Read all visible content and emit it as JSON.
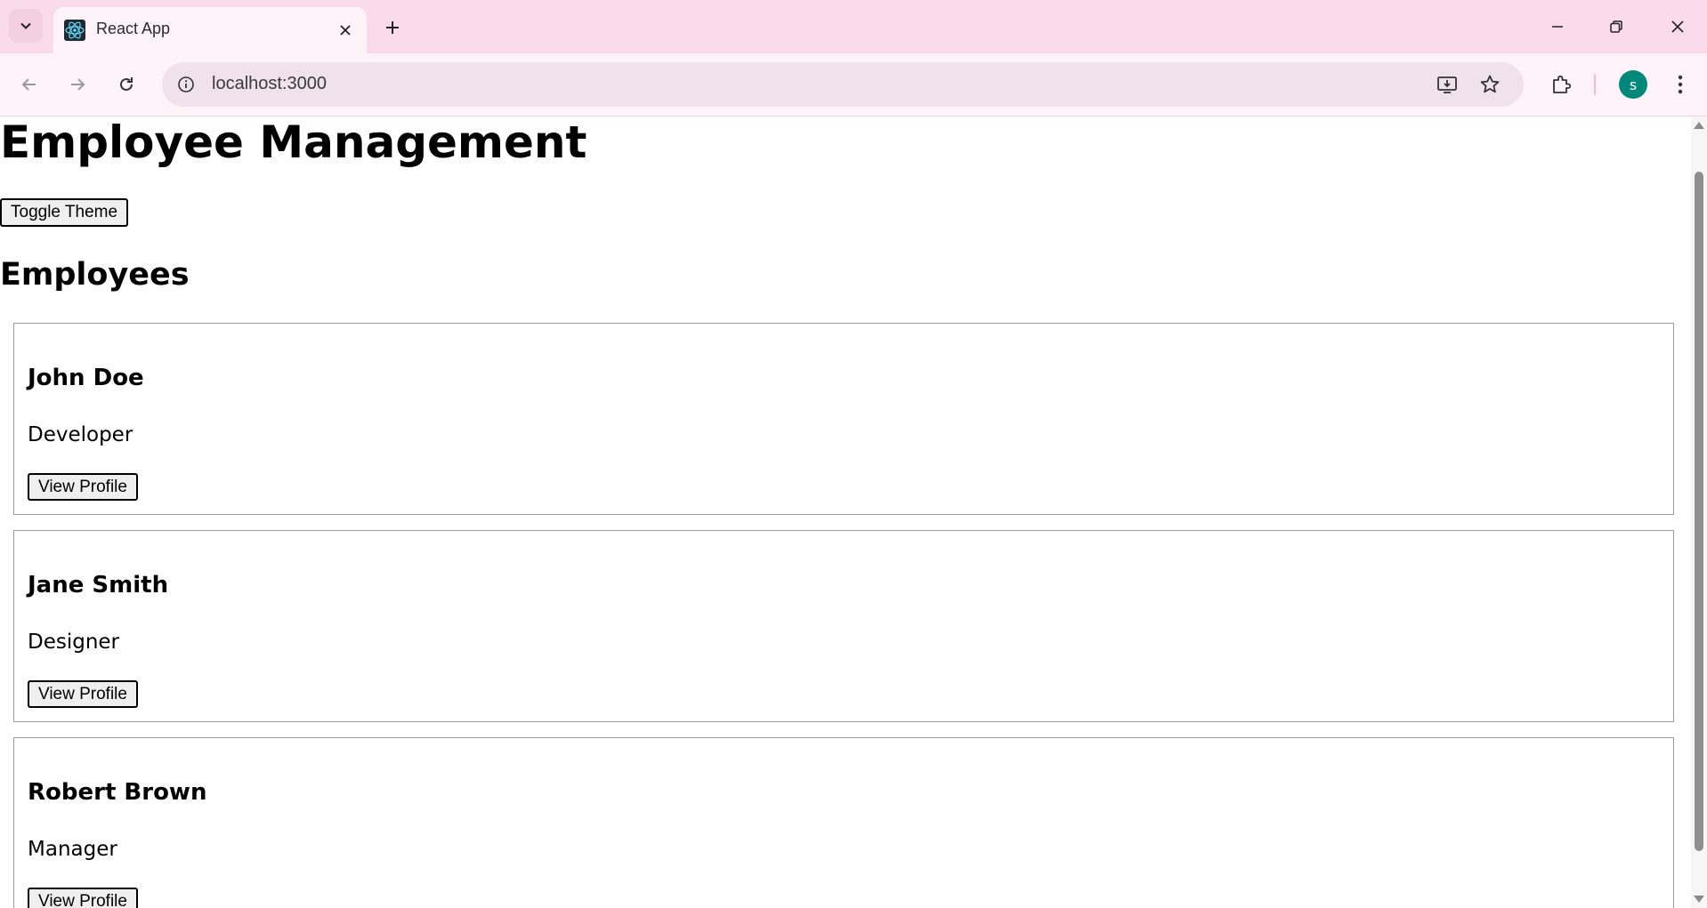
{
  "browser": {
    "tab_title": "React App",
    "url": "localhost:3000",
    "profile_initial": "s",
    "icons": {
      "tab_search": "chevron-down-icon",
      "favicon": "react-logo-icon",
      "tab_close": "close-icon",
      "new_tab": "plus-icon",
      "back": "arrow-left-icon",
      "forward": "arrow-right-icon",
      "reload": "reload-icon",
      "site_info": "info-icon",
      "install": "install-app-icon",
      "bookmark": "star-icon",
      "extensions": "puzzle-icon",
      "menu": "more-vertical-icon",
      "minimize": "minimize-icon",
      "restore": "restore-icon",
      "close_window": "close-icon"
    },
    "colors": {
      "tabbar_bg": "#fadbeb",
      "toolbar_bg": "#fdf3f8",
      "avatar_bg": "#00897b"
    }
  },
  "page": {
    "title": "Employee Management",
    "toggle_label": "Toggle Theme",
    "section_title": "Employees",
    "employees": [
      {
        "name": "John Doe",
        "role": "Developer",
        "button": "View Profile"
      },
      {
        "name": "Jane Smith",
        "role": "Designer",
        "button": "View Profile"
      },
      {
        "name": "Robert Brown",
        "role": "Manager",
        "button": "View Profile"
      }
    ]
  }
}
